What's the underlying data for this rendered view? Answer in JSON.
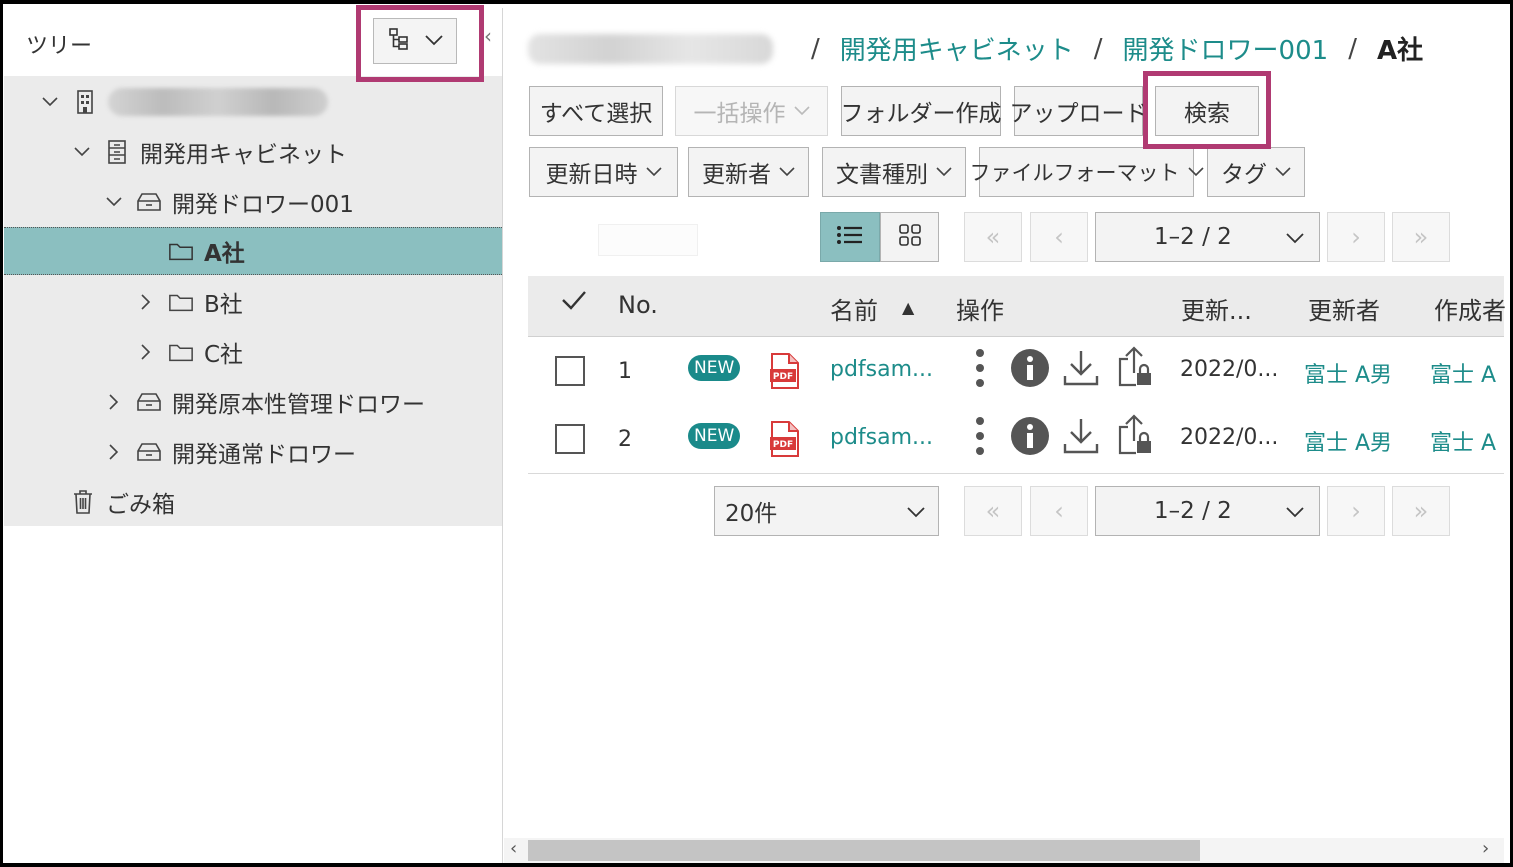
{
  "tree": {
    "title": "ツリー",
    "items": [
      {
        "label": "",
        "type": "root"
      },
      {
        "label": "開発用キャビネット",
        "type": "cabinet"
      },
      {
        "label": "開発ドロワー001",
        "type": "drawer"
      },
      {
        "label": "A社",
        "type": "folder",
        "selected": true
      },
      {
        "label": "B社",
        "type": "folder"
      },
      {
        "label": "C社",
        "type": "folder"
      },
      {
        "label": "開発原本性管理ドロワー",
        "type": "drawer"
      },
      {
        "label": "開発通常ドロワー",
        "type": "drawer"
      },
      {
        "label": "ごみ箱",
        "type": "trash"
      }
    ]
  },
  "breadcrumb": {
    "items": [
      "開発用キャビネット",
      "開発ドロワー001"
    ],
    "current": "A社",
    "separator": "/"
  },
  "toolbar": {
    "select_all": "すべて選択",
    "bulk_ops": "一括操作",
    "create_folder": "フォルダー作成",
    "upload": "アップロード",
    "search": "検索"
  },
  "filters": {
    "updated_at": "更新日時",
    "updater": "更新者",
    "doc_type": "文書種別",
    "file_format": "ファイルフォーマット",
    "tag": "タグ"
  },
  "pagination": {
    "range": "1–2 / 2",
    "per_page": "20件"
  },
  "table": {
    "headers": {
      "no": "No.",
      "name": "名前",
      "sort_indicator": "▲",
      "ops": "操作",
      "updated": "更新...",
      "updater": "更新者",
      "creator": "作成者"
    },
    "rows": [
      {
        "no": "1",
        "badge": "NEW",
        "file_icon": "PDF",
        "name": "pdfsam...",
        "updated": "2022/0...",
        "updater": "富士 A男",
        "creator": "富士 A"
      },
      {
        "no": "2",
        "badge": "NEW",
        "file_icon": "PDF",
        "name": "pdfsam...",
        "updated": "2022/0...",
        "updater": "富士 A男",
        "creator": "富士 A"
      }
    ]
  },
  "colors": {
    "accent": "#1d8c8a",
    "selected_bg": "#8bbfc0",
    "highlight": "#b03a72",
    "pdf_red": "#d83a3a"
  }
}
